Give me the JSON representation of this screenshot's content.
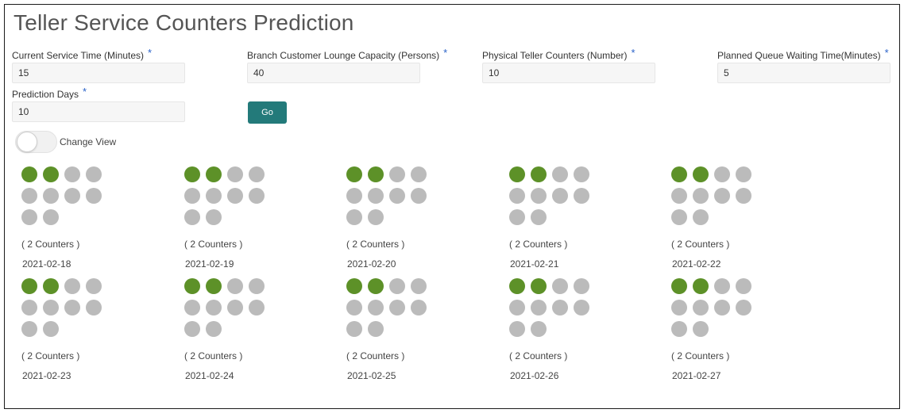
{
  "page": {
    "title": "Teller Service Counters Prediction"
  },
  "form": {
    "current_service_time": {
      "label": "Current Service Time (Minutes)",
      "value": "15",
      "required_mark": "*"
    },
    "lounge_capacity": {
      "label": "Branch Customer Lounge Capacity (Persons)",
      "value": "40",
      "required_mark": "*"
    },
    "physical_counters": {
      "label": "Physical Teller Counters (Number)",
      "value": "10",
      "required_mark": "*"
    },
    "queue_waiting_time": {
      "label": "Planned Queue Waiting Time(Minutes)",
      "value": "5",
      "required_mark": "*"
    },
    "prediction_days": {
      "label": "Prediction Days",
      "value": "10",
      "required_mark": "*"
    },
    "go_label": "Go"
  },
  "view_toggle": {
    "label": "Change View",
    "on": false
  },
  "colors": {
    "active_dot": "#5d9128",
    "inactive_dot": "#bbbbbb",
    "go_button": "#237a7a",
    "required_mark": "#2b63c9"
  },
  "predictions": [
    {
      "counters_text": "( 2 Counters )",
      "date": "2021-02-18",
      "active": 2,
      "total": 10
    },
    {
      "counters_text": "( 2 Counters )",
      "date": "2021-02-19",
      "active": 2,
      "total": 10
    },
    {
      "counters_text": "( 2 Counters )",
      "date": "2021-02-20",
      "active": 2,
      "total": 10
    },
    {
      "counters_text": "( 2 Counters )",
      "date": "2021-02-21",
      "active": 2,
      "total": 10
    },
    {
      "counters_text": "( 2 Counters )",
      "date": "2021-02-22",
      "active": 2,
      "total": 10
    },
    {
      "counters_text": "( 2 Counters )",
      "date": "2021-02-23",
      "active": 2,
      "total": 10
    },
    {
      "counters_text": "( 2 Counters )",
      "date": "2021-02-24",
      "active": 2,
      "total": 10
    },
    {
      "counters_text": "( 2 Counters )",
      "date": "2021-02-25",
      "active": 2,
      "total": 10
    },
    {
      "counters_text": "( 2 Counters )",
      "date": "2021-02-26",
      "active": 2,
      "total": 10
    },
    {
      "counters_text": "( 2 Counters )",
      "date": "2021-02-27",
      "active": 2,
      "total": 10
    }
  ]
}
